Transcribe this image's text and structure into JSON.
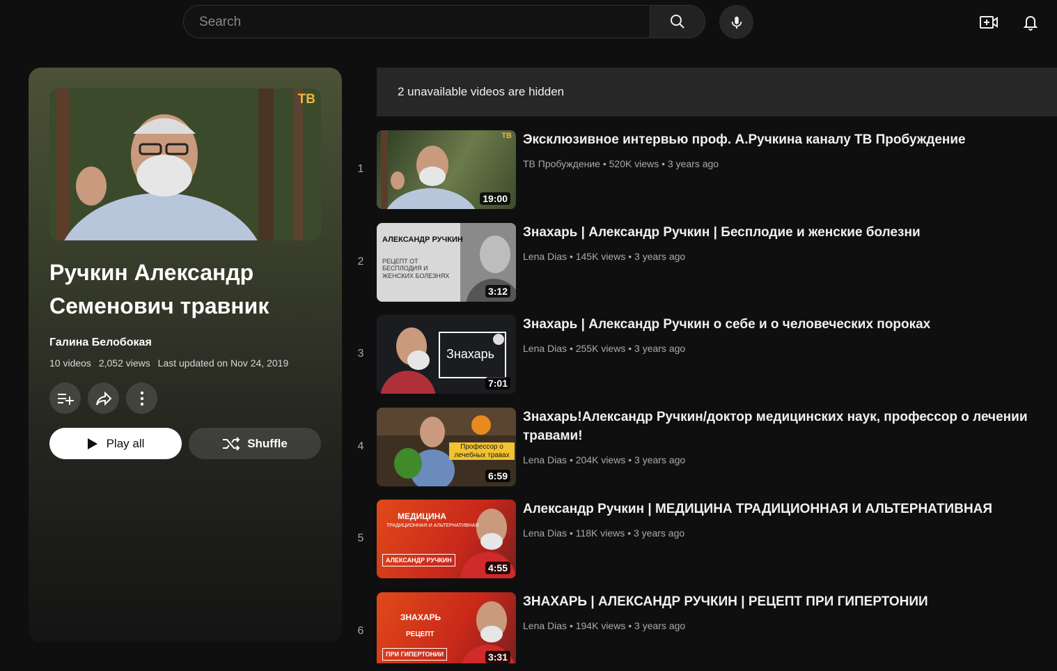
{
  "search": {
    "placeholder": "Search"
  },
  "playlist": {
    "title": "Ручкин Александр Семенович травник",
    "owner": "Галина Белобокая",
    "video_count": "10 videos",
    "views": "2,052 views",
    "updated": "Last updated on Nov 24, 2019",
    "play_all_label": "Play all",
    "shuffle_label": "Shuffle",
    "thumb_logo": "ТВ"
  },
  "hidden_notice": "2 unavailable videos are hidden",
  "videos": [
    {
      "index": "1",
      "title": "Эксклюзивное интервью проф. А.Ручкина каналу ТВ Пробуждение",
      "channel": "ТВ Пробуждение",
      "views": "520K views",
      "age": "3 years ago",
      "duration": "19:00",
      "thumb_text": "ТВ"
    },
    {
      "index": "2",
      "title": "Знахарь | Александр Ручкин | Бесплодие и женские болезни",
      "channel": "Lena Dias",
      "views": "145K views",
      "age": "3 years ago",
      "duration": "3:12",
      "thumb_text": "АЛЕКСАНДР РУЧКИН",
      "thumb_sub": "РЕЦЕПТ ОТ БЕСПЛОДИЯ И ЖЕНСКИХ БОЛЕЗНЯХ"
    },
    {
      "index": "3",
      "title": "Знахарь | Александр Ручкин о себе и о человеческих пороках",
      "channel": "Lena Dias",
      "views": "255K views",
      "age": "3 years ago",
      "duration": "7:01",
      "thumb_text": "Знахарь"
    },
    {
      "index": "4",
      "title": "Знахарь!Александр Ручкин/доктор медицинских наук, профессор о лечении травами!",
      "channel": "Lena Dias",
      "views": "204K views",
      "age": "3 years ago",
      "duration": "6:59",
      "thumb_text": "Профессор о лечебных травах"
    },
    {
      "index": "5",
      "title": "Александр Ручкин | МЕДИЦИНА ТРАДИЦИОННАЯ И АЛЬТЕРНАТИВНАЯ",
      "channel": "Lena Dias",
      "views": "118K views",
      "age": "3 years ago",
      "duration": "4:55",
      "thumb_text": "МЕДИЦИНА",
      "thumb_sub": "ТРАДИЦИОННАЯ И АЛЬТЕРНАТИВНАЯ",
      "thumb_tag": "АЛЕКСАНДР РУЧКИН"
    },
    {
      "index": "6",
      "title": "ЗНАХАРЬ | АЛЕКСАНДР РУЧКИН | РЕЦЕПТ ПРИ ГИПЕРТОНИИ",
      "channel": "Lena Dias",
      "views": "194K views",
      "age": "3 years ago",
      "duration": "3:31",
      "thumb_text": "ЗНАХАРЬ",
      "thumb_sub": "РЕЦЕПТ",
      "thumb_tag": "ПРИ ГИПЕРТОНИИ"
    }
  ],
  "meta_separator": "•"
}
